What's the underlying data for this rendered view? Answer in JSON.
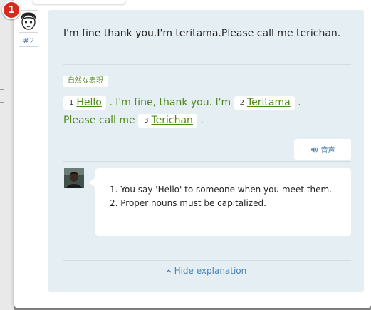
{
  "notification": {
    "count": "1"
  },
  "author": {
    "avatar_icon": "cartoon-face-icon",
    "post_number": "#2"
  },
  "original_text": "I'm fine thank you.I'm teritama.Please call me terichan.",
  "correction": {
    "tag_label": "自然な表現",
    "line1": [
      {
        "num": "1",
        "word": "Hello"
      },
      {
        "text": ". I'm fine, thank you. I'm"
      },
      {
        "num": "2",
        "word": "Teritama"
      },
      {
        "text": "."
      }
    ],
    "line2": [
      {
        "text": "Please call me"
      },
      {
        "num": "3",
        "word": "Terichan"
      },
      {
        "text": "."
      }
    ]
  },
  "audio_button": {
    "icon": "speaker-icon",
    "label": "音声"
  },
  "explanation": {
    "lines": [
      "1. You say 'Hello' to someone when you meet them.",
      "2. Proper nouns must be capitalized."
    ]
  },
  "hide_link": {
    "icon": "chevron-up-icon",
    "label": "Hide explanation"
  },
  "colors": {
    "accent_green": "#4e8a17",
    "link_blue": "#4a83b5",
    "badge_red": "#d62a1e",
    "panel_bg": "#e4eef3"
  }
}
